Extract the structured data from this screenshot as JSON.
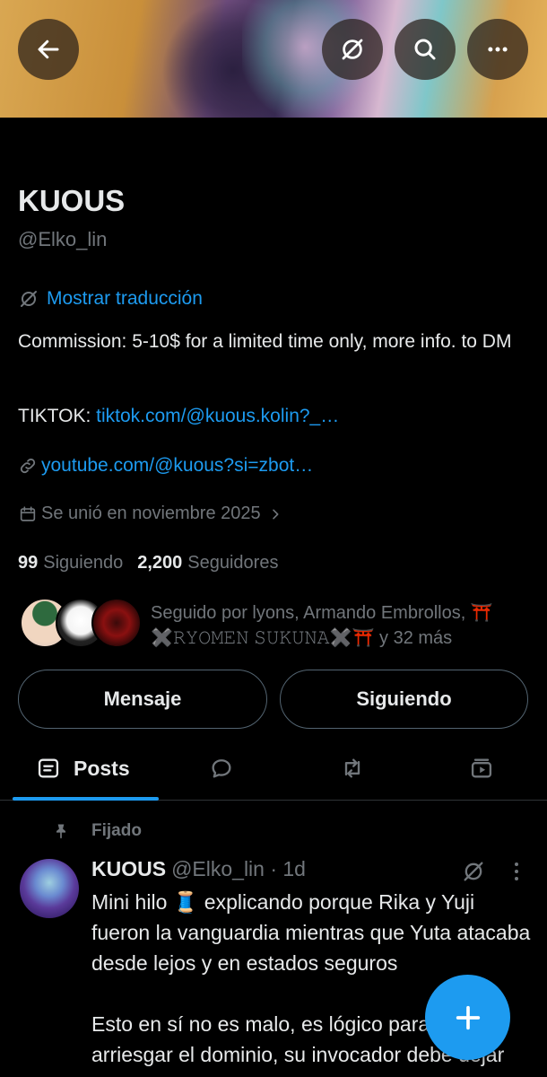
{
  "profile": {
    "name": "KUOUS",
    "handle": "@Elko_lin",
    "translate_label": "Mostrar traducción",
    "bio_line": "Commission: 5-10$ for a limited time only, more info. to DM",
    "tiktok_label": "TIKTOK: ",
    "tiktok_link": "tiktok.com/@kuous.kolin?_…",
    "youtube_link": "youtube.com/@kuous?si=zbot…",
    "joined": "Se unió en noviembre 2025",
    "following_count": "99",
    "following_label": "Siguiendo",
    "followers_count": "2,200",
    "followers_label": "Seguidores",
    "followed_by": "Seguido por lyons, Armando Embrollos, ⛩️ ✖️𝚁𝚈𝙾𝙼𝙴𝙽 𝚂𝚄𝙺𝚄𝙽𝙰✖️⛩️ y 32 más"
  },
  "buttons": {
    "message": "Mensaje",
    "following": "Siguiendo"
  },
  "tabs": {
    "posts": "Posts"
  },
  "post": {
    "pinned_label": "Fijado",
    "author": "KUOUS",
    "handle_time": "@Elko_lin · 1d",
    "paragraph1": "Mini hilo 🧵 explicando porque Rika y Yuji fueron la vanguardia mientras que Yuta atacaba desde lejos y en estados seguros",
    "paragraph2": "Esto en sí no es malo, es lógico para no arriesgar el dominio, su invocador debe dejar pelado dim…"
  },
  "colors": {
    "accent": "#1d9bf0",
    "background": "#000000",
    "muted": "#71767b",
    "text": "#e7e9ea"
  }
}
